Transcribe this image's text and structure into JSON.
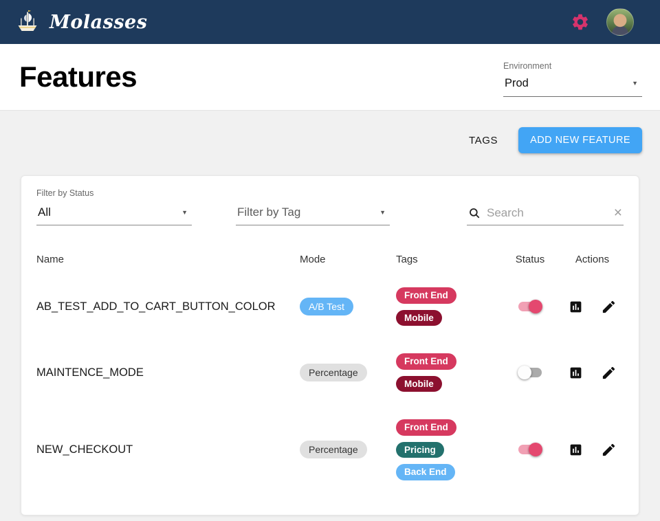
{
  "navbar": {
    "brand": "Molasses"
  },
  "header": {
    "title": "Features",
    "environment": {
      "label": "Environment",
      "value": "Prod"
    }
  },
  "toolbar": {
    "tags_button": "TAGS",
    "add_feature_button": "ADD NEW FEATURE"
  },
  "filters": {
    "status": {
      "label": "Filter by Status",
      "value": "All"
    },
    "tag": {
      "placeholder": "Filter by Tag"
    },
    "search": {
      "placeholder": "Search"
    }
  },
  "glyphs": {
    "dropdown_arrow": "▼",
    "clear_x": "×"
  },
  "table": {
    "headers": {
      "name": "Name",
      "mode": "Mode",
      "tags": "Tags",
      "status": "Status",
      "actions": "Actions"
    },
    "rows": [
      {
        "name": "AB_TEST_ADD_TO_CART_BUTTON_COLOR",
        "mode": {
          "label": "A/B Test",
          "bg": "#64b5f6",
          "fg": "#ffffff"
        },
        "tags": [
          {
            "label": "Front End",
            "bg": "#d6395f",
            "fg": "#ffffff"
          },
          {
            "label": "Mobile",
            "bg": "#8c102f",
            "fg": "#ffffff"
          }
        ],
        "status_on": true
      },
      {
        "name": "MAINTENCE_MODE",
        "mode": {
          "label": "Percentage",
          "bg": "#e0e0e0",
          "fg": "#333333"
        },
        "tags": [
          {
            "label": "Front End",
            "bg": "#d6395f",
            "fg": "#ffffff"
          },
          {
            "label": "Mobile",
            "bg": "#8c102f",
            "fg": "#ffffff"
          }
        ],
        "status_on": false
      },
      {
        "name": "NEW_CHECKOUT",
        "mode": {
          "label": "Percentage",
          "bg": "#e0e0e0",
          "fg": "#333333"
        },
        "tags": [
          {
            "label": "Front End",
            "bg": "#d6395f",
            "fg": "#ffffff"
          },
          {
            "label": "Pricing",
            "bg": "#23716d",
            "fg": "#ffffff"
          },
          {
            "label": "Back End",
            "bg": "#64b5f6",
            "fg": "#ffffff"
          }
        ],
        "status_on": true
      }
    ]
  },
  "colors": {
    "navbar_bg": "#1e3a5c",
    "accent_pink": "#d6336c",
    "primary_blue": "#42a5f5",
    "toggle_on_thumb": "#e4486f",
    "toggle_on_track": "#f1a0b4"
  }
}
